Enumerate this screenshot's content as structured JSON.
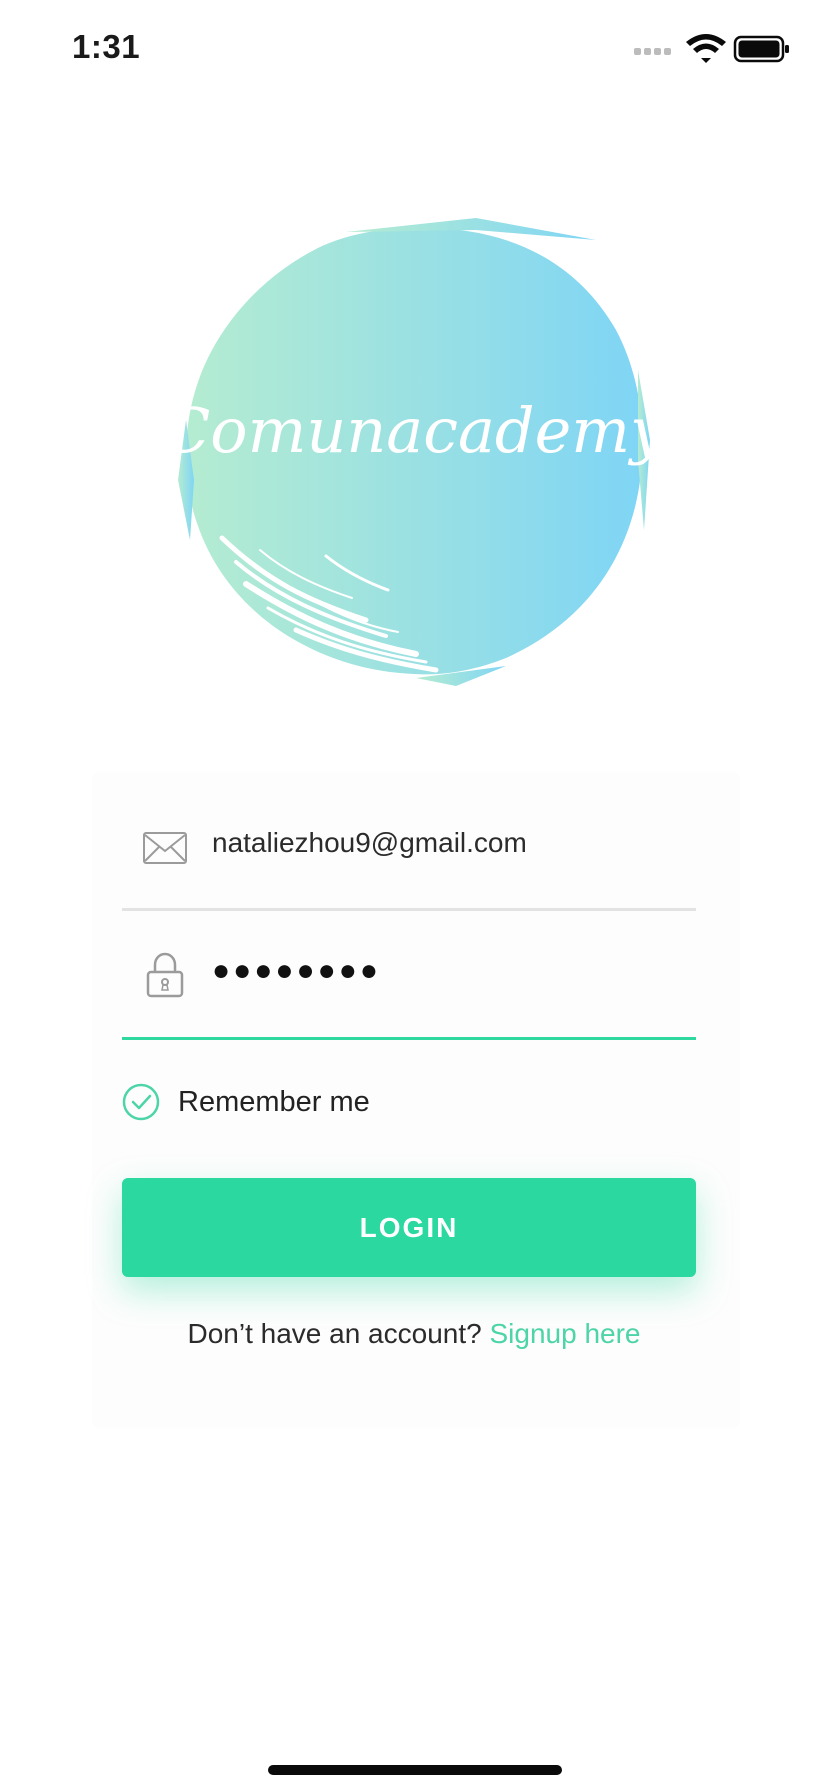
{
  "status_bar": {
    "time": "1:31",
    "icons": [
      "signal-icon",
      "wifi-icon",
      "battery-icon"
    ]
  },
  "logo": {
    "text": "Comunacademy",
    "colors": [
      "#b5ecd1",
      "#7fd5f5"
    ]
  },
  "form": {
    "email_value": "nataliezhou9@gmail.com",
    "email_icon": "envelope-icon",
    "password_value": "●●●●●●●●",
    "password_icon": "lock-icon",
    "remember_label": "Remember me",
    "remember_checked": true,
    "login_label": "LOGIN",
    "signup_prompt": "Don’t have an account?",
    "signup_link": "Signup here"
  },
  "colors": {
    "accent": "#2ad8a0",
    "link": "#4dd4a8",
    "underline_inactive": "#e3e3e3"
  }
}
